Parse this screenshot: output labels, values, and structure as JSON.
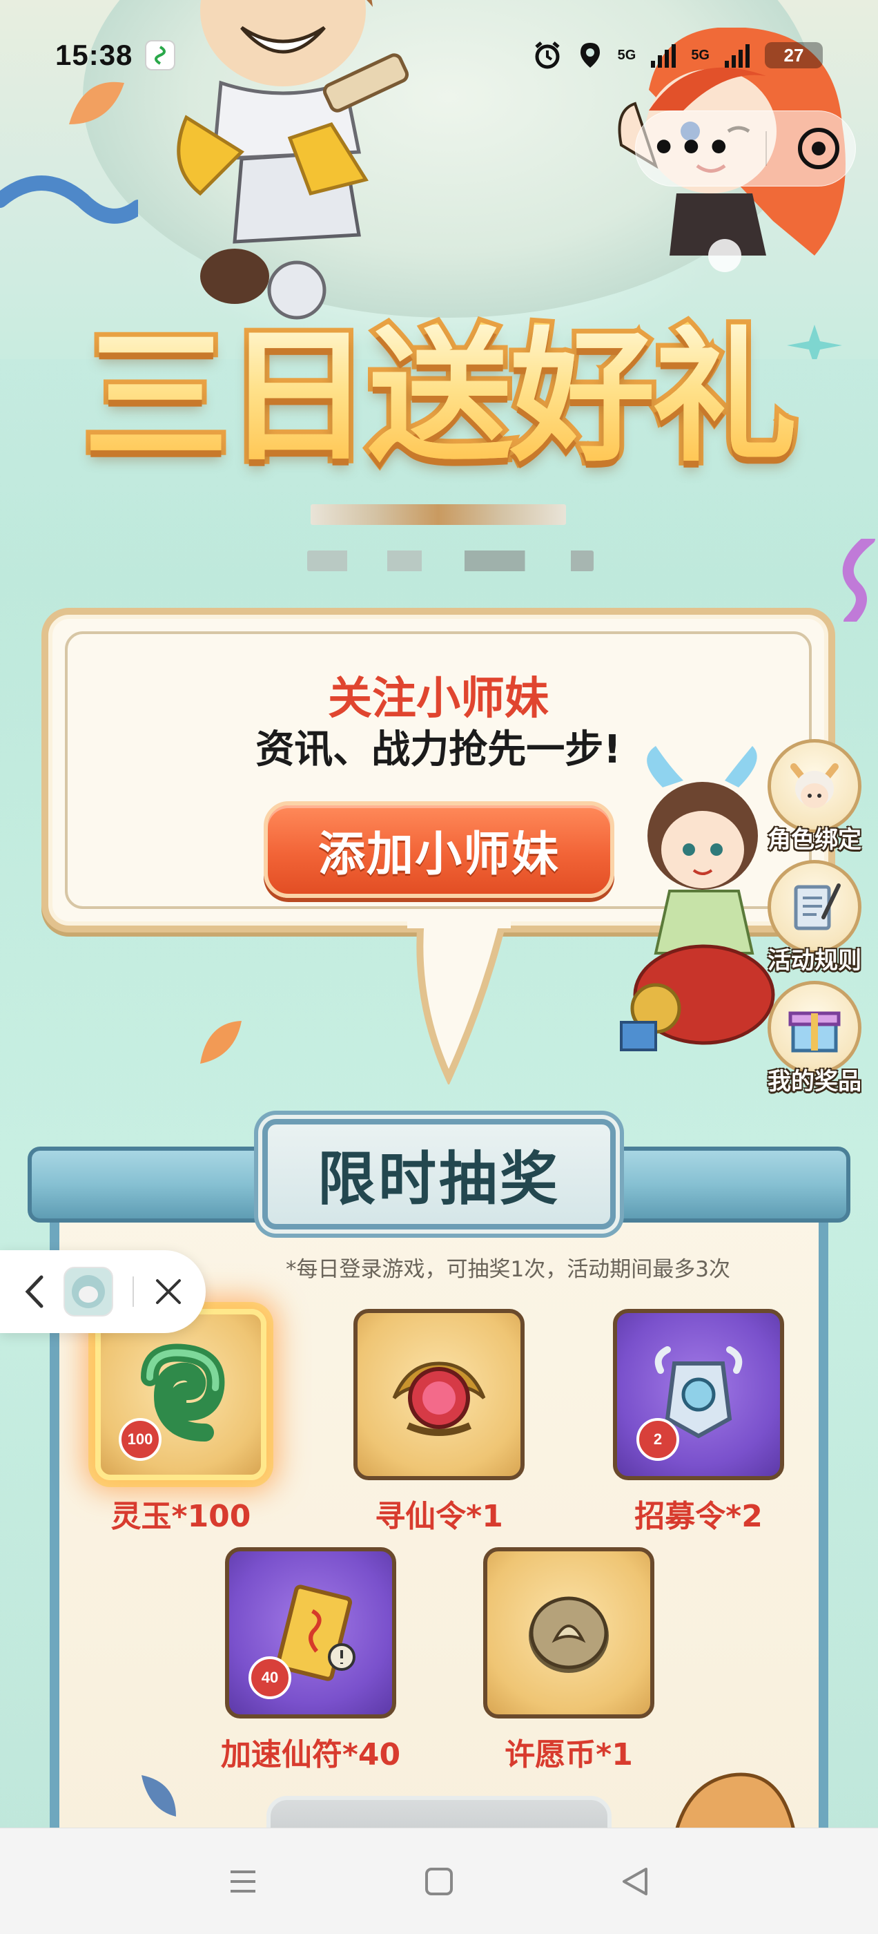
{
  "status_bar": {
    "time": "15:38",
    "network_1": "5G",
    "network_2": "5G",
    "battery": "27"
  },
  "capsule": {
    "more_label": "•••"
  },
  "banner": {
    "title": "三日送好礼"
  },
  "follow_card": {
    "title": "关注小师妹",
    "subtitle": "资讯、战力抢先一步!",
    "button_label": "添加小师妹"
  },
  "side_menu": {
    "items": [
      {
        "label": "角色绑定",
        "icon": "character-bind-icon"
      },
      {
        "label": "活动规则",
        "icon": "rules-scroll-icon"
      },
      {
        "label": "我的奖品",
        "icon": "gift-box-icon"
      }
    ]
  },
  "lottery": {
    "title": "限时抽奖",
    "note": "*每日登录游戏，可抽奖1次，活动期间最多3次",
    "prizes": [
      {
        "label": "灵玉*100",
        "badge": "100",
        "bg": "gold",
        "selected": true,
        "icon": "jade-icon"
      },
      {
        "label": "寻仙令*1",
        "badge": "",
        "bg": "gold",
        "selected": false,
        "icon": "immortal-token-icon"
      },
      {
        "label": "招募令*2",
        "badge": "2",
        "bg": "purple",
        "selected": false,
        "icon": "recruit-token-icon"
      },
      {
        "label": "加速仙符*40",
        "badge": "40",
        "bg": "purple",
        "selected": false,
        "icon": "speed-talisman-icon"
      },
      {
        "label": "许愿币*1",
        "badge": "",
        "bg": "gold",
        "selected": false,
        "icon": "wish-coin-icon"
      }
    ]
  },
  "colors": {
    "accent_red": "#d83b2e",
    "button_orange": "#f26437",
    "background_mint": "#c8efe2"
  }
}
